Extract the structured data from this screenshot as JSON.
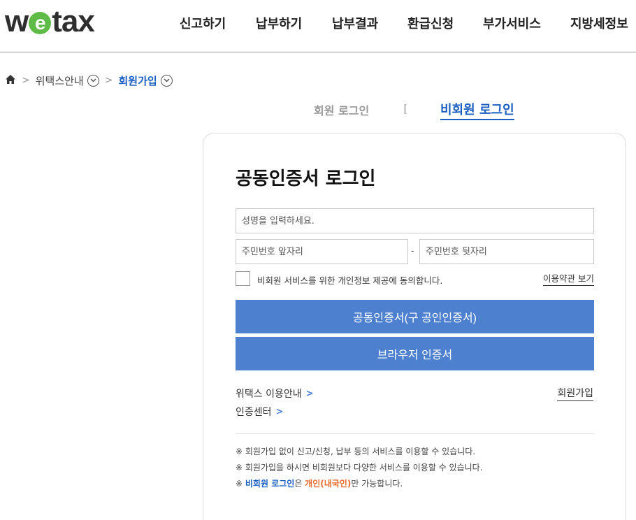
{
  "header": {
    "logo_w": "w",
    "logo_e": "e",
    "logo_rest": "tax",
    "nav": [
      "신고하기",
      "납부하기",
      "납부결과",
      "환급신청",
      "부가서비스",
      "지방세정보"
    ]
  },
  "breadcrumb": {
    "home_icon": "home-icon",
    "items": [
      "위택스안내",
      "회원가입"
    ]
  },
  "tabs": {
    "member": "회원 로그인",
    "guest": "비회원 로그인"
  },
  "login": {
    "title": "공동인증서 로그인",
    "name_placeholder": "성명을 입력하세요.",
    "rrn_front_placeholder": "주민번호 앞자리",
    "rrn_dash": "-",
    "rrn_back_placeholder": "주민번호 뒷자리",
    "agree_text": "비회원 서비스를 위한 개인정보 제공에 동의합니다.",
    "terms_link": "이용약관 보기",
    "cert_button": "공동인증서(구 공인인증서)",
    "browser_button": "브라우저 인증서",
    "guide_link": "위택스 이용안내",
    "cert_center_link": "인증센터",
    "join_link": "회원가입"
  },
  "notes": {
    "mark": "※",
    "note1": "회원가입 없이 신고/신청, 납부 등의 서비스를 이용할 수 있습니다.",
    "note2": "회원가입을 하시면 비회원보다 다양한 서비스를 이용할 수 있습니다.",
    "note3_a": "비회원 로그인",
    "note3_b": "은 ",
    "note3_c": "개인(내국인)",
    "note3_d": "만 가능합니다."
  },
  "colors": {
    "primary_button": "#4d80cf",
    "accent_blue": "#1b5fc2",
    "accent_orange": "#e86b2c",
    "logo_green": "#5dbb46"
  }
}
